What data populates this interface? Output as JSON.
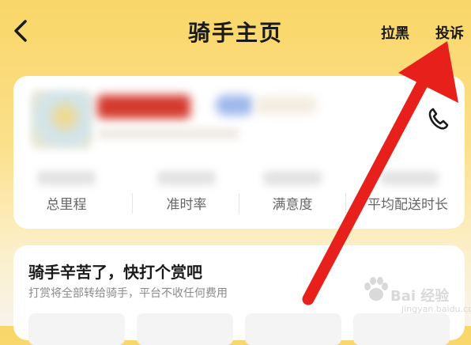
{
  "header": {
    "title": "骑手主页",
    "actions": [
      {
        "label": "拉黑"
      },
      {
        "label": "投诉"
      }
    ]
  },
  "rider_card": {
    "stats": [
      {
        "label": "总里程"
      },
      {
        "label": "准时率"
      },
      {
        "label": "满意度"
      },
      {
        "label": "平均配送时长"
      }
    ]
  },
  "tip_card": {
    "title": "骑手辛苦了，快打个赏吧",
    "subtitle": "打赏将全部转给骑手，平台不收任何费用"
  },
  "annotation": {
    "arrow_color": "#e8201c"
  },
  "watermark": {
    "text": "Bai 经验",
    "sub": "jingyan.baidu.com"
  },
  "icons": [
    "back-icon",
    "phone-icon",
    "red-arrow-annotation",
    "paw-watermark-icon"
  ]
}
